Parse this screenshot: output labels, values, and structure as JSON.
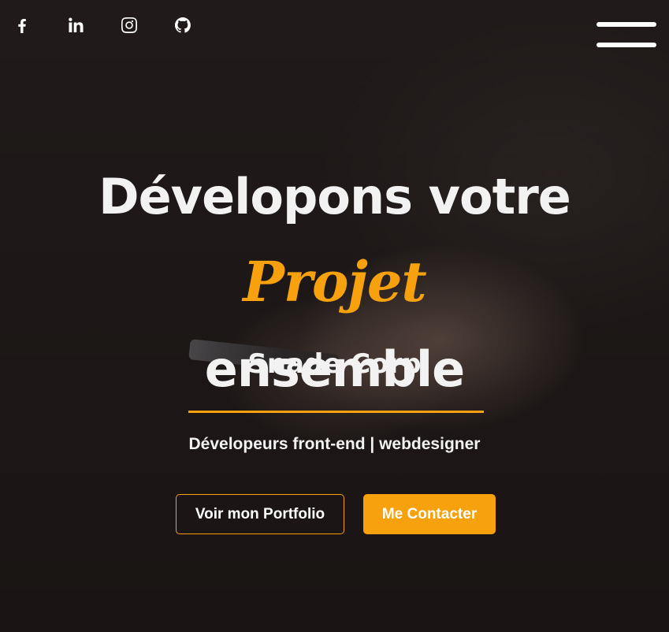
{
  "social": [
    {
      "name": "facebook",
      "icon": "facebook-icon"
    },
    {
      "name": "linkedin",
      "icon": "linkedin-icon"
    },
    {
      "name": "instagram",
      "icon": "instagram-icon"
    },
    {
      "name": "github",
      "icon": "github-icon"
    }
  ],
  "menu": {
    "icon": "hamburger-menu-icon"
  },
  "hero": {
    "headline_part1": "Dévelopons votre ",
    "headline_accent": "Projet",
    "headline_part2": "ensemble",
    "brand": "Snade Corp",
    "subtitle": "Dévelopeurs front-end | webdesigner",
    "portfolio_button": "Voir mon Portfolio",
    "contact_button": "Me Contacter"
  },
  "colors": {
    "accent": "#f6a10d",
    "text": "#f2f2f2",
    "background": "#1b1615"
  }
}
